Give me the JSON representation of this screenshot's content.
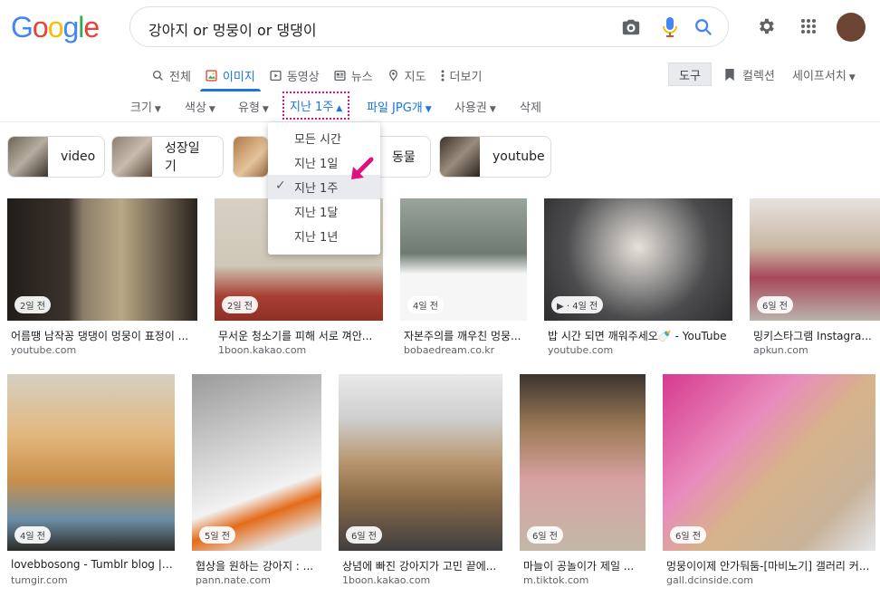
{
  "logo": [
    "G",
    "o",
    "o",
    "g",
    "l",
    "e"
  ],
  "search": {
    "query": "강아지 or 멍뭉이 or 댕댕이"
  },
  "tabs": [
    {
      "label": "전체",
      "icon": "search-icon"
    },
    {
      "label": "이미지",
      "icon": "image-icon",
      "active": true
    },
    {
      "label": "동영상",
      "icon": "video-icon"
    },
    {
      "label": "뉴스",
      "icon": "news-icon"
    },
    {
      "label": "지도",
      "icon": "map-pin-icon"
    },
    {
      "label": "더보기",
      "icon": "more-vert-icon"
    }
  ],
  "tools_label": "도구",
  "collections_label": "컬렉션",
  "safesearch_label": "세이프서치",
  "filters": {
    "size": "크기",
    "color": "색상",
    "type": "유형",
    "time": "지난 1주",
    "file": "파일 JPG개",
    "rights": "사용권",
    "clear": "삭제"
  },
  "chips": [
    {
      "label": "video"
    },
    {
      "label": "성장일기"
    },
    {
      "label": ""
    },
    {
      "label": "동물"
    },
    {
      "label": "youtube"
    }
  ],
  "time_menu": [
    {
      "label": "모든 시간"
    },
    {
      "label": "지난 1일"
    },
    {
      "label": "지난 1주",
      "selected": true
    },
    {
      "label": "지난 1달"
    },
    {
      "label": "지난 1년"
    }
  ],
  "results": [
    {
      "badge": "2일 전",
      "caption": "어름땡 남작꽁 댕댕이 멍뭉이 표정이 ...",
      "source": "youtube.com"
    },
    {
      "badge": "2일 전",
      "caption": "무서운 청소기를 피해 서로 껴안...",
      "source": "1boon.kakao.com"
    },
    {
      "badge": "4일 전",
      "caption": "자본주의를 깨우친 멍뭉...",
      "source": "bobaedream.co.kr"
    },
    {
      "badge": "▶ · 4일 전",
      "caption": "밥 시간 되면 깨워주세오🍼 - YouTube",
      "source": "youtube.com"
    },
    {
      "badge": "6일 전",
      "caption": "밍키스타그램 Instagra...",
      "source": "apkun.com"
    },
    {
      "badge": "4일 전",
      "caption": "lovebbosong - Tumblr blog | Tu...",
      "source": "tumgir.com"
    },
    {
      "badge": "5일 전",
      "caption": "협상을 원하는 강아지 : ...",
      "source": "pann.nate.com"
    },
    {
      "badge": "6일 전",
      "caption": "상념에 빠진 강아지가 고민 끝에...",
      "source": "1boon.kakao.com"
    },
    {
      "badge": "6일 전",
      "caption": "마늘이 공놀이가 제일 ...",
      "source": "m.tiktok.com"
    },
    {
      "badge": "6일 전",
      "caption": "멍뭉이이제 안가둬둠-[마비노기] 갤러리 커...",
      "source": "gall.dcinside.com"
    }
  ],
  "colors": {
    "accent": "#1a73e8",
    "highlight": "#e0117f"
  }
}
